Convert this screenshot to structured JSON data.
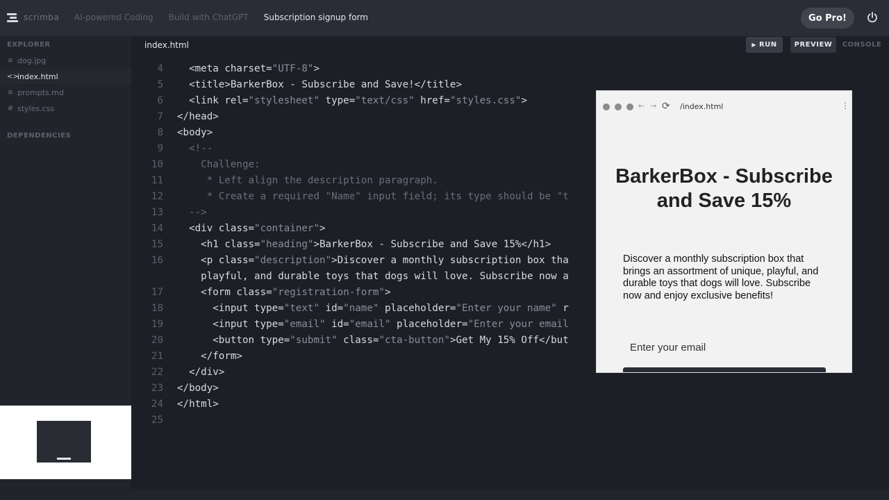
{
  "app": {
    "logo_word": "scrimba",
    "breadcrumbs": [
      "AI-powered Coding",
      "Build with ChatGPT",
      "Subscription signup form"
    ],
    "go_pro": "Go Pro!"
  },
  "sidebar": {
    "explorer_label": "EXPLORER",
    "files": [
      {
        "icon": "≡",
        "name": "dog.jpg"
      },
      {
        "icon": "<>",
        "name": "index.html"
      },
      {
        "icon": "≡",
        "name": "prompts.md"
      },
      {
        "icon": "#",
        "name": "styles.css"
      }
    ],
    "dependencies_label": "DEPENDENCIES"
  },
  "editor": {
    "tab": "index.html",
    "run_label": "RUN",
    "preview_label": "PREVIEW",
    "console_label": "CONSOLE",
    "lines": [
      {
        "n": "4",
        "t": "  <meta charset=\"UTF-8\">"
      },
      {
        "n": "5",
        "t": "  <title>BarkerBox - Subscribe and Save!</title>"
      },
      {
        "n": "6",
        "t": "  <link rel=\"stylesheet\" type=\"text/css\" href=\"styles.css\">"
      },
      {
        "n": "7",
        "t": "</head>"
      },
      {
        "n": "8",
        "t": "<body>"
      },
      {
        "n": "9",
        "t": "  <!--"
      },
      {
        "n": "10",
        "t": "    Challenge:"
      },
      {
        "n": "11",
        "t": "     * Left align the description paragraph."
      },
      {
        "n": "12",
        "t": "     * Create a required \"Name\" input field; its type should be \"t"
      },
      {
        "n": "13",
        "t": "  -->"
      },
      {
        "n": "14",
        "t": "  <div class=\"container\">"
      },
      {
        "n": "15",
        "t": "    <h1 class=\"heading\">BarkerBox - Subscribe and Save 15%</h1>"
      },
      {
        "n": "16",
        "t": "    <p class=\"description\">Discover a monthly subscription box tha"
      },
      {
        "n": "",
        "t": "    playful, and durable toys that dogs will love. Subscribe now a"
      },
      {
        "n": "17",
        "t": "    <form class=\"registration-form\">"
      },
      {
        "n": "18",
        "t": "      <input type=\"text\" id=\"name\" placeholder=\"Enter your name\" r"
      },
      {
        "n": "19",
        "t": "      <input type=\"email\" id=\"email\" placeholder=\"Enter your email"
      },
      {
        "n": "20",
        "t": "      <button type=\"submit\" class=\"cta-button\">Get My 15% Off</but"
      },
      {
        "n": "21",
        "t": "    </form>"
      },
      {
        "n": "22",
        "t": "  </div>"
      },
      {
        "n": "23",
        "t": "</body>"
      },
      {
        "n": "24",
        "t": "</html>"
      },
      {
        "n": "25",
        "t": ""
      }
    ]
  },
  "preview": {
    "url": "/index.html",
    "heading": "BarkerBox - Subscribe and Save 15%",
    "description": "Discover a monthly subscription box that brings an assortment of unique, playful, and durable toys that dogs will love. Subscribe now and enjoy exclusive benefits!",
    "email_placeholder": "Enter your email"
  }
}
